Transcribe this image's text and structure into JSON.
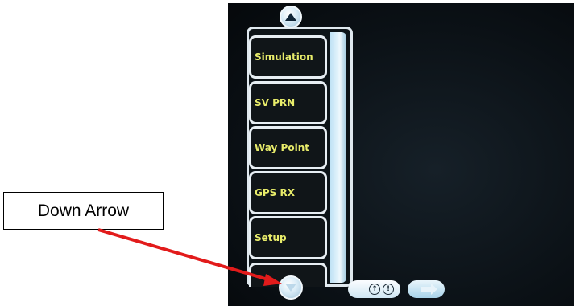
{
  "menu": {
    "items": [
      {
        "label": "Simulation"
      },
      {
        "label": "SV PRN"
      },
      {
        "label": "Way Point"
      },
      {
        "label": "GPS RX"
      },
      {
        "label": "Setup"
      },
      {
        "label": ""
      }
    ],
    "scroll_up_icon": "triangle-up-icon",
    "scroll_down_icon": "triangle-down-icon"
  },
  "status_bar": {
    "icons": [
      "clock-icon",
      "alert-icon"
    ],
    "clock_glyph": "↑",
    "alert_glyph": "!",
    "next_icon": "arrow-right-icon"
  },
  "annotation": {
    "callout_label": "Down Arrow",
    "arrow_color": "#e21b1b"
  },
  "colors": {
    "screen_bg": "#0b1116",
    "menu_text": "#e8ec6a",
    "button_border": "#e7eef3",
    "accent": "#bfe2f5"
  }
}
